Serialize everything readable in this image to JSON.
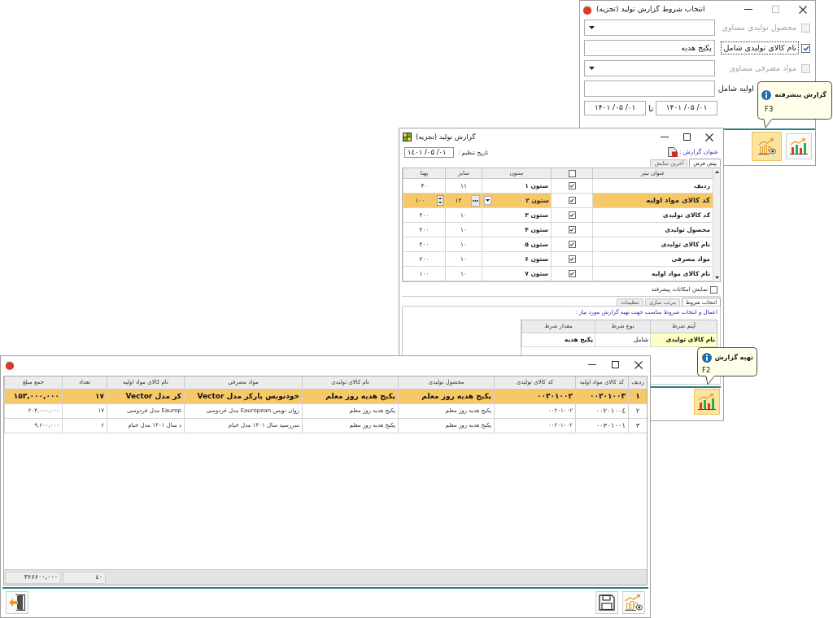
{
  "conditions_window": {
    "title": "انتخاب شروط گزارش تولید (تجزیه)",
    "controls": [
      {
        "kind": "minimize",
        "disabled": false
      },
      {
        "kind": "maximize",
        "disabled": true
      },
      {
        "kind": "close",
        "disabled": false
      }
    ],
    "conditions": [
      {
        "kind": "dropdown",
        "label": "محصول تولیدی مساوی",
        "checked": false,
        "disabled": true,
        "focused": false
      },
      {
        "kind": "text",
        "label": "نام کالای تولیدی شامل",
        "checked": true,
        "disabled": false,
        "focused": true,
        "value": "پکیج هدیه"
      },
      {
        "kind": "dropdown",
        "label": "مواد مصرفی مساوی",
        "checked": false,
        "disabled": true,
        "focused": false
      },
      {
        "kind": "text",
        "label": "اولیه شامل",
        "disabled": false,
        "focused": false
      }
    ],
    "date_range": {
      "from": "۱۴۰۱ /۰۵ /۰۱",
      "separator": "تا",
      "to": "۱۴۰۱ /۰۵ /۰۱"
    },
    "buttons": [
      {
        "kind": "advanced_report",
        "hovered": true
      },
      {
        "kind": "report",
        "hovered": false
      }
    ],
    "tooltip": {
      "title": "گزارش پیشرفته",
      "shortcut": "F3"
    }
  },
  "settings_window": {
    "title": "گزارش تولید (تجزیه)",
    "controls": [
      {
        "kind": "minimize",
        "disabled": false
      },
      {
        "kind": "maximize",
        "disabled": false
      },
      {
        "kind": "close",
        "disabled": false
      }
    ],
    "report_title_label": "عنوان گزارش :",
    "date_label": "تاریخ تنظیم :",
    "date": "۱٤۰۱ /۰۵ /۰۱",
    "tabs": [
      {
        "label": "پیش فرض",
        "selected": true
      },
      {
        "label": "آخرین نمایش",
        "selected": false
      }
    ],
    "columns_table": {
      "columns": [
        {
          "kind": "text",
          "label": "عنوان تیتر"
        },
        {
          "kind": "checkbox",
          "checked": false
        },
        {
          "kind": "text",
          "label": "ستون"
        },
        {
          "kind": "text",
          "label": "سایز"
        },
        {
          "kind": "text",
          "label": "پهنا"
        }
      ],
      "rows": [
        {
          "selected": false,
          "cells": [
            {
              "kind": "text",
              "text": "ردیف"
            },
            {
              "kind": "checkbox",
              "checked": true
            },
            {
              "kind": "text",
              "text": "ستون ۱"
            },
            {
              "kind": "text",
              "text": "۱۱"
            },
            {
              "kind": "text",
              "text": "۴۰"
            }
          ]
        },
        {
          "selected": true,
          "cells": [
            {
              "kind": "text",
              "text": "کد کالای مواد اولیه"
            },
            {
              "kind": "checkbox",
              "checked": true
            },
            {
              "kind": "dropdown",
              "text": "ستون ۲"
            },
            {
              "kind": "ellipsis",
              "text": "۱۲"
            },
            {
              "kind": "spinner",
              "text": "۱۰۰"
            }
          ]
        },
        {
          "selected": false,
          "cells": [
            {
              "kind": "text",
              "text": "کد کالای تولیدی"
            },
            {
              "kind": "checkbox",
              "checked": true
            },
            {
              "kind": "text",
              "text": "ستون ۳"
            },
            {
              "kind": "text",
              "text": "۱۰"
            },
            {
              "kind": "text",
              "text": "۲۰۰"
            }
          ]
        },
        {
          "selected": false,
          "cells": [
            {
              "kind": "text",
              "text": "محصول تولیدی"
            },
            {
              "kind": "checkbox",
              "checked": true
            },
            {
              "kind": "text",
              "text": "ستون ۴"
            },
            {
              "kind": "text",
              "text": "۱۰"
            },
            {
              "kind": "text",
              "text": "۲۰۰"
            }
          ]
        },
        {
          "selected": false,
          "cells": [
            {
              "kind": "text",
              "text": "نام کالای تولیدی"
            },
            {
              "kind": "checkbox",
              "checked": true
            },
            {
              "kind": "text",
              "text": "ستون ۵"
            },
            {
              "kind": "text",
              "text": "۱۰"
            },
            {
              "kind": "text",
              "text": "۲۰۰"
            }
          ]
        },
        {
          "selected": false,
          "cells": [
            {
              "kind": "text",
              "text": "مواد مصرفی"
            },
            {
              "kind": "checkbox",
              "checked": true
            },
            {
              "kind": "text",
              "text": "ستون ۶"
            },
            {
              "kind": "text",
              "text": "۱۰"
            },
            {
              "kind": "text",
              "text": "۲۰۰"
            }
          ]
        },
        {
          "selected": false,
          "cells": [
            {
              "kind": "text",
              "text": "نام کالای مواد اولیه"
            },
            {
              "kind": "checkbox",
              "checked": true
            },
            {
              "kind": "text",
              "text": "ستون ۷"
            },
            {
              "kind": "text",
              "text": "۱۰"
            },
            {
              "kind": "text",
              "text": "۱۰۰"
            }
          ]
        }
      ]
    },
    "advanced_option": {
      "label": "نمایش امکانات پیشرفته",
      "checked": false
    },
    "condition_tabs": [
      {
        "label": "انتخاب شروط",
        "selected": true
      },
      {
        "label": "مرتب سازی",
        "selected": false
      },
      {
        "label": "تنظیمات",
        "selected": false
      }
    ],
    "hint": "اعمال و انتخاب شروط مناسب جهت تهیه گزارش مورد نیاز :",
    "conditions_table": {
      "columns": [
        "آیتم شرط",
        "نوع شرط",
        "مقدار شرط"
      ],
      "rows": [
        {
          "selected": true,
          "cells": [
            "نام کالای تولیدی",
            "شامل",
            "پکیج هدیه"
          ]
        }
      ]
    },
    "buttons": [
      {
        "kind": "report",
        "hovered": true
      }
    ],
    "tooltip": {
      "title": "تهیه گزارش",
      "shortcut": "F2"
    }
  },
  "result_window": {
    "controls": [
      {
        "kind": "minimize",
        "disabled": false
      },
      {
        "kind": "maximize",
        "disabled": false
      },
      {
        "kind": "close",
        "disabled": false
      }
    ],
    "columns": [
      "ردیف",
      "کد کالای مواد اولیه",
      "کد کالای تولیدی",
      "محصول تولیدی",
      "نام کالای تولیدی",
      "مواد مصرفی",
      "نام کالای مواد اولیه",
      "تعداد",
      "جمع مبلغ"
    ],
    "rows": [
      {
        "selected": true,
        "cells": [
          "۱",
          "۰۰۲۰۱۰۰۳",
          "۰۰۲۰۱۰۰۲",
          "پکیج هدیه روز معلم",
          "پکیج هدیه روز معلم",
          "خودنویس پارکر مدل Vector",
          "کر مدل Vector",
          "۱۷",
          "۱۵۳,۰۰۰,۰۰۰"
        ]
      },
      {
        "selected": false,
        "cells": [
          "۲",
          "۰۰۲۰۱۰۰٤",
          "۰۰۲۰۱۰۰۲",
          "پکیج هدیه روز معلم",
          "پکیج هدیه روز معلم",
          "روان نویس Eauropean مدل فردوسی",
          "Eaurop مدل فردوسی",
          "۱۷",
          "۲۰۴,۰۰۰,۰۰۰"
        ]
      },
      {
        "selected": false,
        "cells": [
          "۳",
          "۰۰۳۰۱۰۰۱",
          "۰۰۲۰۱۰۰۲",
          "پکیج هدیه روز معلم",
          "پکیج هدیه روز معلم",
          "سررسید سال ۱۴۰۱ مدل خیام",
          "د سال ۱۴۰۱ مدل خیام",
          "۶",
          "۹,۶۰۰,۰۰۰"
        ]
      }
    ],
    "totals": {
      "amount": "۳۶۶۶۰۰,۰۰۰",
      "quantity": "٤٠"
    },
    "buttons": [
      {
        "kind": "exit"
      },
      {
        "kind": "save"
      },
      {
        "kind": "advanced_report"
      }
    ]
  }
}
